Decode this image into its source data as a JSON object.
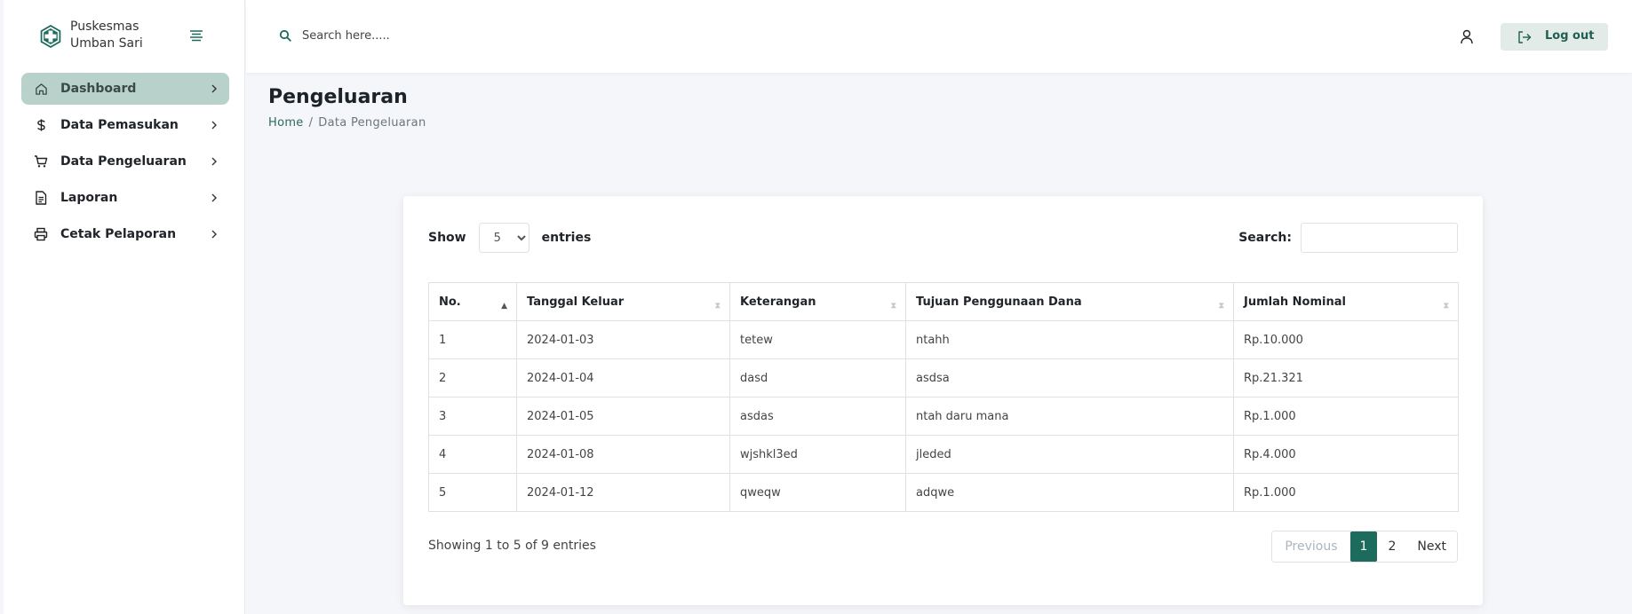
{
  "brand": {
    "name": "Puskesmas Umban Sari",
    "accent": "#1d6b5c"
  },
  "sidebar": {
    "items": [
      {
        "label": "Dashboard",
        "icon": "home-icon",
        "active": true
      },
      {
        "label": "Data Pemasukan",
        "icon": "dollar-icon",
        "active": false
      },
      {
        "label": "Data Pengeluaran",
        "icon": "cart-icon",
        "active": false
      },
      {
        "label": "Laporan",
        "icon": "file-text-icon",
        "active": false
      },
      {
        "label": "Cetak Pelaporan",
        "icon": "printer-icon",
        "active": false
      }
    ]
  },
  "header": {
    "search_placeholder": "Search here.....",
    "logout_label": "Log out"
  },
  "page": {
    "title": "Pengeluaran",
    "breadcrumb": [
      "Home",
      "Data Pengeluaran"
    ]
  },
  "table": {
    "length_prefix": "Show",
    "length_value": "5",
    "length_suffix": "entries",
    "search_label": "Search:",
    "columns": [
      "No.",
      "Tanggal Keluar",
      "Keterangan",
      "Tujuan Penggunaan Dana",
      "Jumlah Nominal"
    ],
    "rows": [
      [
        "1",
        "2024-01-03",
        "tetew",
        "ntahh",
        "Rp.10.000"
      ],
      [
        "2",
        "2024-01-04",
        "dasd",
        "asdsa",
        "Rp.21.321"
      ],
      [
        "3",
        "2024-01-05",
        "asdas",
        "ntah daru mana",
        "Rp.1.000"
      ],
      [
        "4",
        "2024-01-08",
        "wjshkl3ed",
        "jleded",
        "Rp.4.000"
      ],
      [
        "5",
        "2024-01-12",
        "qweqw",
        "adqwe",
        "Rp.1.000"
      ]
    ],
    "info": "Showing 1 to 5 of 9 entries",
    "pagination": {
      "previous": "Previous",
      "pages": [
        "1",
        "2"
      ],
      "next": "Next"
    }
  }
}
